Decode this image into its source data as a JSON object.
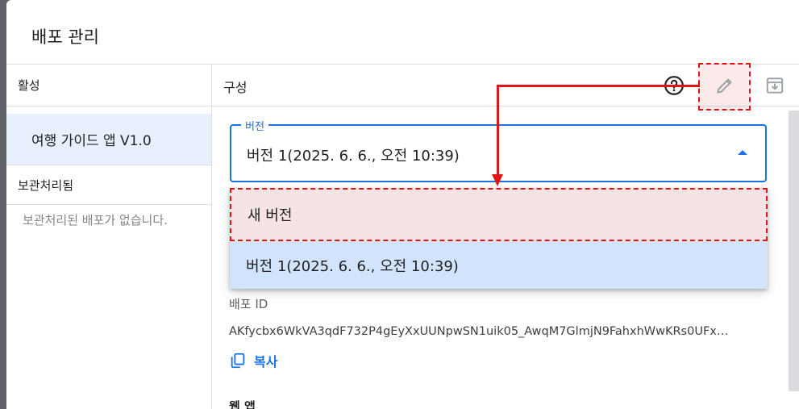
{
  "dialog": {
    "title": "배포 관리"
  },
  "sidebar": {
    "active_label": "활성",
    "active_item": "여행 가이드 앱 V1.0",
    "archived_label": "보관처리됨",
    "archived_empty": "보관처리된 배포가 없습니다."
  },
  "config": {
    "label": "구성",
    "icons": {
      "help": "help-circle-icon",
      "edit": "pencil-icon",
      "archive": "archive-icon"
    }
  },
  "version_field": {
    "label": "버전",
    "value": "버전 1(2025. 6. 6., 오전 10:39)"
  },
  "dropdown": {
    "options": [
      "새 버전",
      "버전 1(2025. 6. 6., 오전 10:39)"
    ],
    "selected_index": 1
  },
  "deployment": {
    "id_label": "배포 ID",
    "id_value": "AKfycbx6WkVA3qdF732P4gEyXxUUNpwSN1uik05_AwqM7GlmjN9FahxhWwKRs0UFx…",
    "copy_label": "복사"
  },
  "web_app": {
    "label": "웹 앱"
  },
  "colors": {
    "accent": "#1a73e8",
    "annotation": "#e01414",
    "selected_bg": "#d2e3fc",
    "sidebar_selected_bg": "#e8f0fe"
  }
}
